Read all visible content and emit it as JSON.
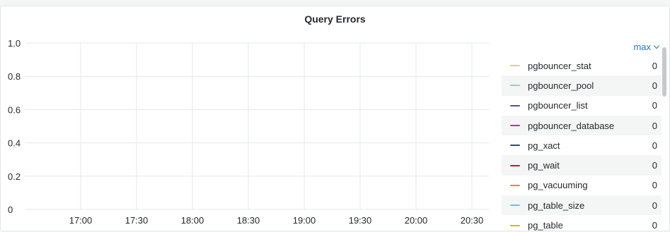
{
  "panel": {
    "title": "Query Errors"
  },
  "chart_data": {
    "type": "line",
    "title": "Query Errors",
    "x_ticks": [
      "17:00",
      "17:30",
      "18:00",
      "18:30",
      "19:00",
      "19:30",
      "20:00",
      "20:30"
    ],
    "y_ticks": [
      "1.0",
      "0.8",
      "0.6",
      "0.4",
      "0.2",
      "0"
    ],
    "ylim": [
      0,
      1
    ],
    "grid": true,
    "legend_placement": "right",
    "series": [
      {
        "name": "pgbouncer_stat",
        "color": "#f2c96d",
        "max": "0"
      },
      {
        "name": "pgbouncer_pool",
        "color": "#96d98d",
        "max": "0"
      },
      {
        "name": "pgbouncer_list",
        "color": "#5a4f9e",
        "max": "0"
      },
      {
        "name": "pgbouncer_database",
        "color": "#b8359c",
        "max": "0"
      },
      {
        "name": "pg_xact",
        "color": "#1f4e9e",
        "max": "0"
      },
      {
        "name": "pg_wait",
        "color": "#c4162a",
        "max": "0"
      },
      {
        "name": "pg_vacuuming",
        "color": "#ff7f2a",
        "max": "0"
      },
      {
        "name": "pg_table_size",
        "color": "#73bfe8",
        "max": "0"
      },
      {
        "name": "pg_table",
        "color": "#e0b400",
        "max": "0"
      }
    ]
  },
  "legend": {
    "sort_label": "max"
  }
}
